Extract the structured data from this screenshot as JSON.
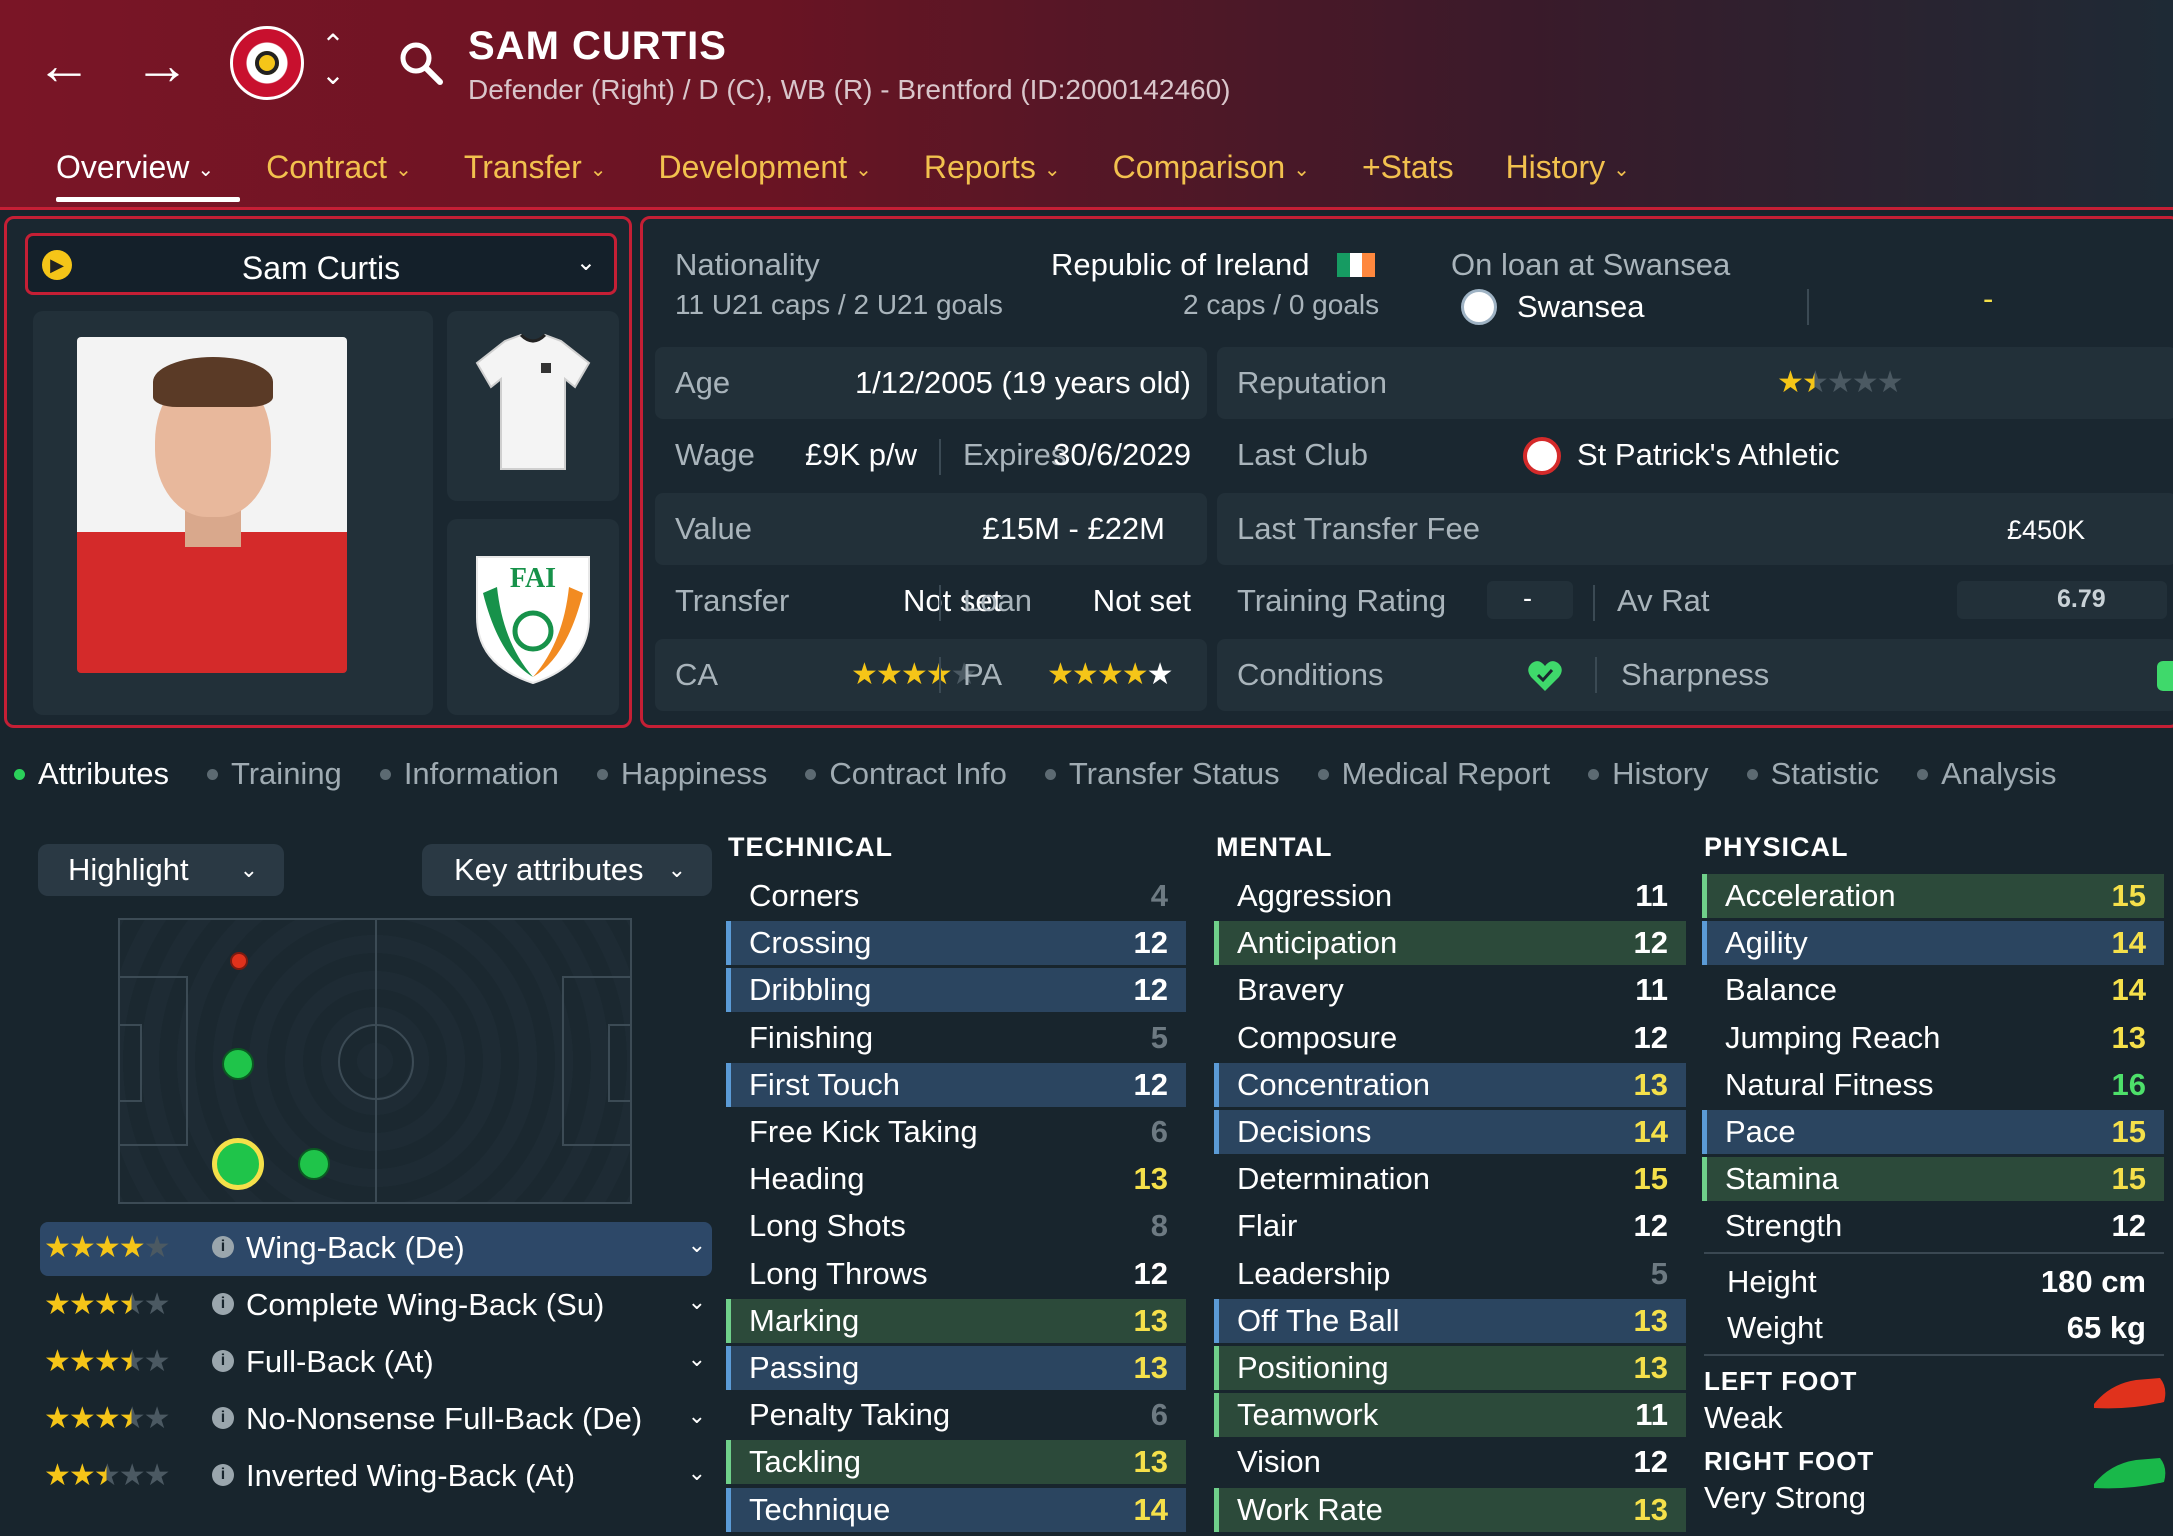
{
  "header": {
    "name": "SAM CURTIS",
    "subtitle": "Defender (Right) / D (C), WB (R) - Brentford (ID:2000142460)",
    "tabs": [
      {
        "label": "Overview",
        "chev": "⌄"
      },
      {
        "label": "Contract",
        "chev": "⌄"
      },
      {
        "label": "Transfer",
        "chev": "⌄"
      },
      {
        "label": "Development",
        "chev": "⌄"
      },
      {
        "label": "Reports",
        "chev": "⌄"
      },
      {
        "label": "Comparison",
        "chev": "⌄"
      },
      {
        "label": "+Stats",
        "chev": ""
      },
      {
        "label": "History",
        "chev": "⌄"
      }
    ]
  },
  "player_select": {
    "name": "Sam Curtis"
  },
  "info": {
    "nationality_label": "Nationality",
    "nationality": "Republic of Ireland",
    "u21": "11 U21 caps / 2 U21 goals",
    "caps": "2 caps / 0 goals",
    "loan_label": "On loan at Swansea",
    "loan_club": "Swansea",
    "loan_dash": "-",
    "age_label": "Age",
    "age": "1/12/2005 (19 years old)",
    "reputation_label": "Reputation",
    "reputation_stars": 1.5,
    "wage_label": "Wage",
    "wage": "£9K p/w",
    "expires_label": "Expires",
    "expires": "30/6/2029",
    "last_club_label": "Last Club",
    "last_club": "St Patrick's Athletic",
    "value_label": "Value",
    "value": "£15M - £22M",
    "last_fee_label": "Last Transfer Fee",
    "last_fee": "£450K",
    "transfer_label": "Transfer",
    "transfer": "Not set",
    "loan_label2": "Loan",
    "loan": "Not set",
    "training_label": "Training Rating",
    "training": "-",
    "avrat_label": "Av Rat",
    "avrat": "6.79",
    "ca_label": "CA",
    "ca_stars": 4,
    "pa_label": "PA",
    "pa_stars": 5,
    "conditions_label": "Conditions",
    "sharpness_label": "Sharpness"
  },
  "subtabs": [
    "Attributes",
    "Training",
    "Information",
    "Happiness",
    "Contract Info",
    "Transfer Status",
    "Medical Report",
    "History",
    "Statistic",
    "Analysis"
  ],
  "controls": {
    "highlight": "Highlight",
    "key_attributes": "Key attributes"
  },
  "roles": [
    {
      "name": "Wing-Back (De)",
      "stars": 4
    },
    {
      "name": "Complete Wing-Back (Su)",
      "stars": 3.5
    },
    {
      "name": "Full-Back (At)",
      "stars": 3.5
    },
    {
      "name": "No-Nonsense Full-Back (De)",
      "stars": 3.5
    },
    {
      "name": "Inverted Wing-Back (At)",
      "stars": 2.5
    }
  ],
  "technical": {
    "title": "TECHNICAL",
    "items": [
      {
        "name": "Corners",
        "value": "4",
        "hl": "plain"
      },
      {
        "name": "Crossing",
        "value": "12",
        "hl": "blue"
      },
      {
        "name": "Dribbling",
        "value": "12",
        "hl": "blue"
      },
      {
        "name": "Finishing",
        "value": "5",
        "hl": "plain"
      },
      {
        "name": "First Touch",
        "value": "12",
        "hl": "blue"
      },
      {
        "name": "Free Kick Taking",
        "value": "6",
        "hl": "plain"
      },
      {
        "name": "Heading",
        "value": "13",
        "hl": "plain"
      },
      {
        "name": "Long Shots",
        "value": "8",
        "hl": "plain"
      },
      {
        "name": "Long Throws",
        "value": "12",
        "hl": "plain"
      },
      {
        "name": "Marking",
        "value": "13",
        "hl": "green"
      },
      {
        "name": "Passing",
        "value": "13",
        "hl": "blue"
      },
      {
        "name": "Penalty Taking",
        "value": "6",
        "hl": "plain"
      },
      {
        "name": "Tackling",
        "value": "13",
        "hl": "green"
      },
      {
        "name": "Technique",
        "value": "14",
        "hl": "blue"
      }
    ]
  },
  "mental": {
    "title": "MENTAL",
    "items": [
      {
        "name": "Aggression",
        "value": "11",
        "hl": "plain"
      },
      {
        "name": "Anticipation",
        "value": "12",
        "hl": "green"
      },
      {
        "name": "Bravery",
        "value": "11",
        "hl": "plain"
      },
      {
        "name": "Composure",
        "value": "12",
        "hl": "plain"
      },
      {
        "name": "Concentration",
        "value": "13",
        "hl": "blue"
      },
      {
        "name": "Decisions",
        "value": "14",
        "hl": "blue"
      },
      {
        "name": "Determination",
        "value": "15",
        "hl": "plain"
      },
      {
        "name": "Flair",
        "value": "12",
        "hl": "plain"
      },
      {
        "name": "Leadership",
        "value": "5",
        "hl": "plain"
      },
      {
        "name": "Off The Ball",
        "value": "13",
        "hl": "blue"
      },
      {
        "name": "Positioning",
        "value": "13",
        "hl": "green"
      },
      {
        "name": "Teamwork",
        "value": "11",
        "hl": "green"
      },
      {
        "name": "Vision",
        "value": "12",
        "hl": "plain"
      },
      {
        "name": "Work Rate",
        "value": "13",
        "hl": "green"
      }
    ]
  },
  "physical": {
    "title": "PHYSICAL",
    "items": [
      {
        "name": "Acceleration",
        "value": "15",
        "hl": "green"
      },
      {
        "name": "Agility",
        "value": "14",
        "hl": "blue"
      },
      {
        "name": "Balance",
        "value": "14",
        "hl": "plain"
      },
      {
        "name": "Jumping Reach",
        "value": "13",
        "hl": "plain"
      },
      {
        "name": "Natural Fitness",
        "value": "16",
        "hl": "plain"
      },
      {
        "name": "Pace",
        "value": "15",
        "hl": "blue"
      },
      {
        "name": "Stamina",
        "value": "15",
        "hl": "green"
      },
      {
        "name": "Strength",
        "value": "12",
        "hl": "plain"
      }
    ],
    "height_label": "Height",
    "height": "180 cm",
    "weight_label": "Weight",
    "weight": "65 kg",
    "left_foot_label": "LEFT FOOT",
    "left_foot": "Weak",
    "right_foot_label": "RIGHT FOOT",
    "right_foot": "Very Strong"
  },
  "colors": {
    "header_red": "#7a1526",
    "accent_red": "#c51f35",
    "tab_yellow": "#f2c14e",
    "highlight_blue": "#2b4560",
    "highlight_green": "#2c4a3a",
    "value_green": "#4de06a",
    "value_yellow": "#f5e04a"
  }
}
